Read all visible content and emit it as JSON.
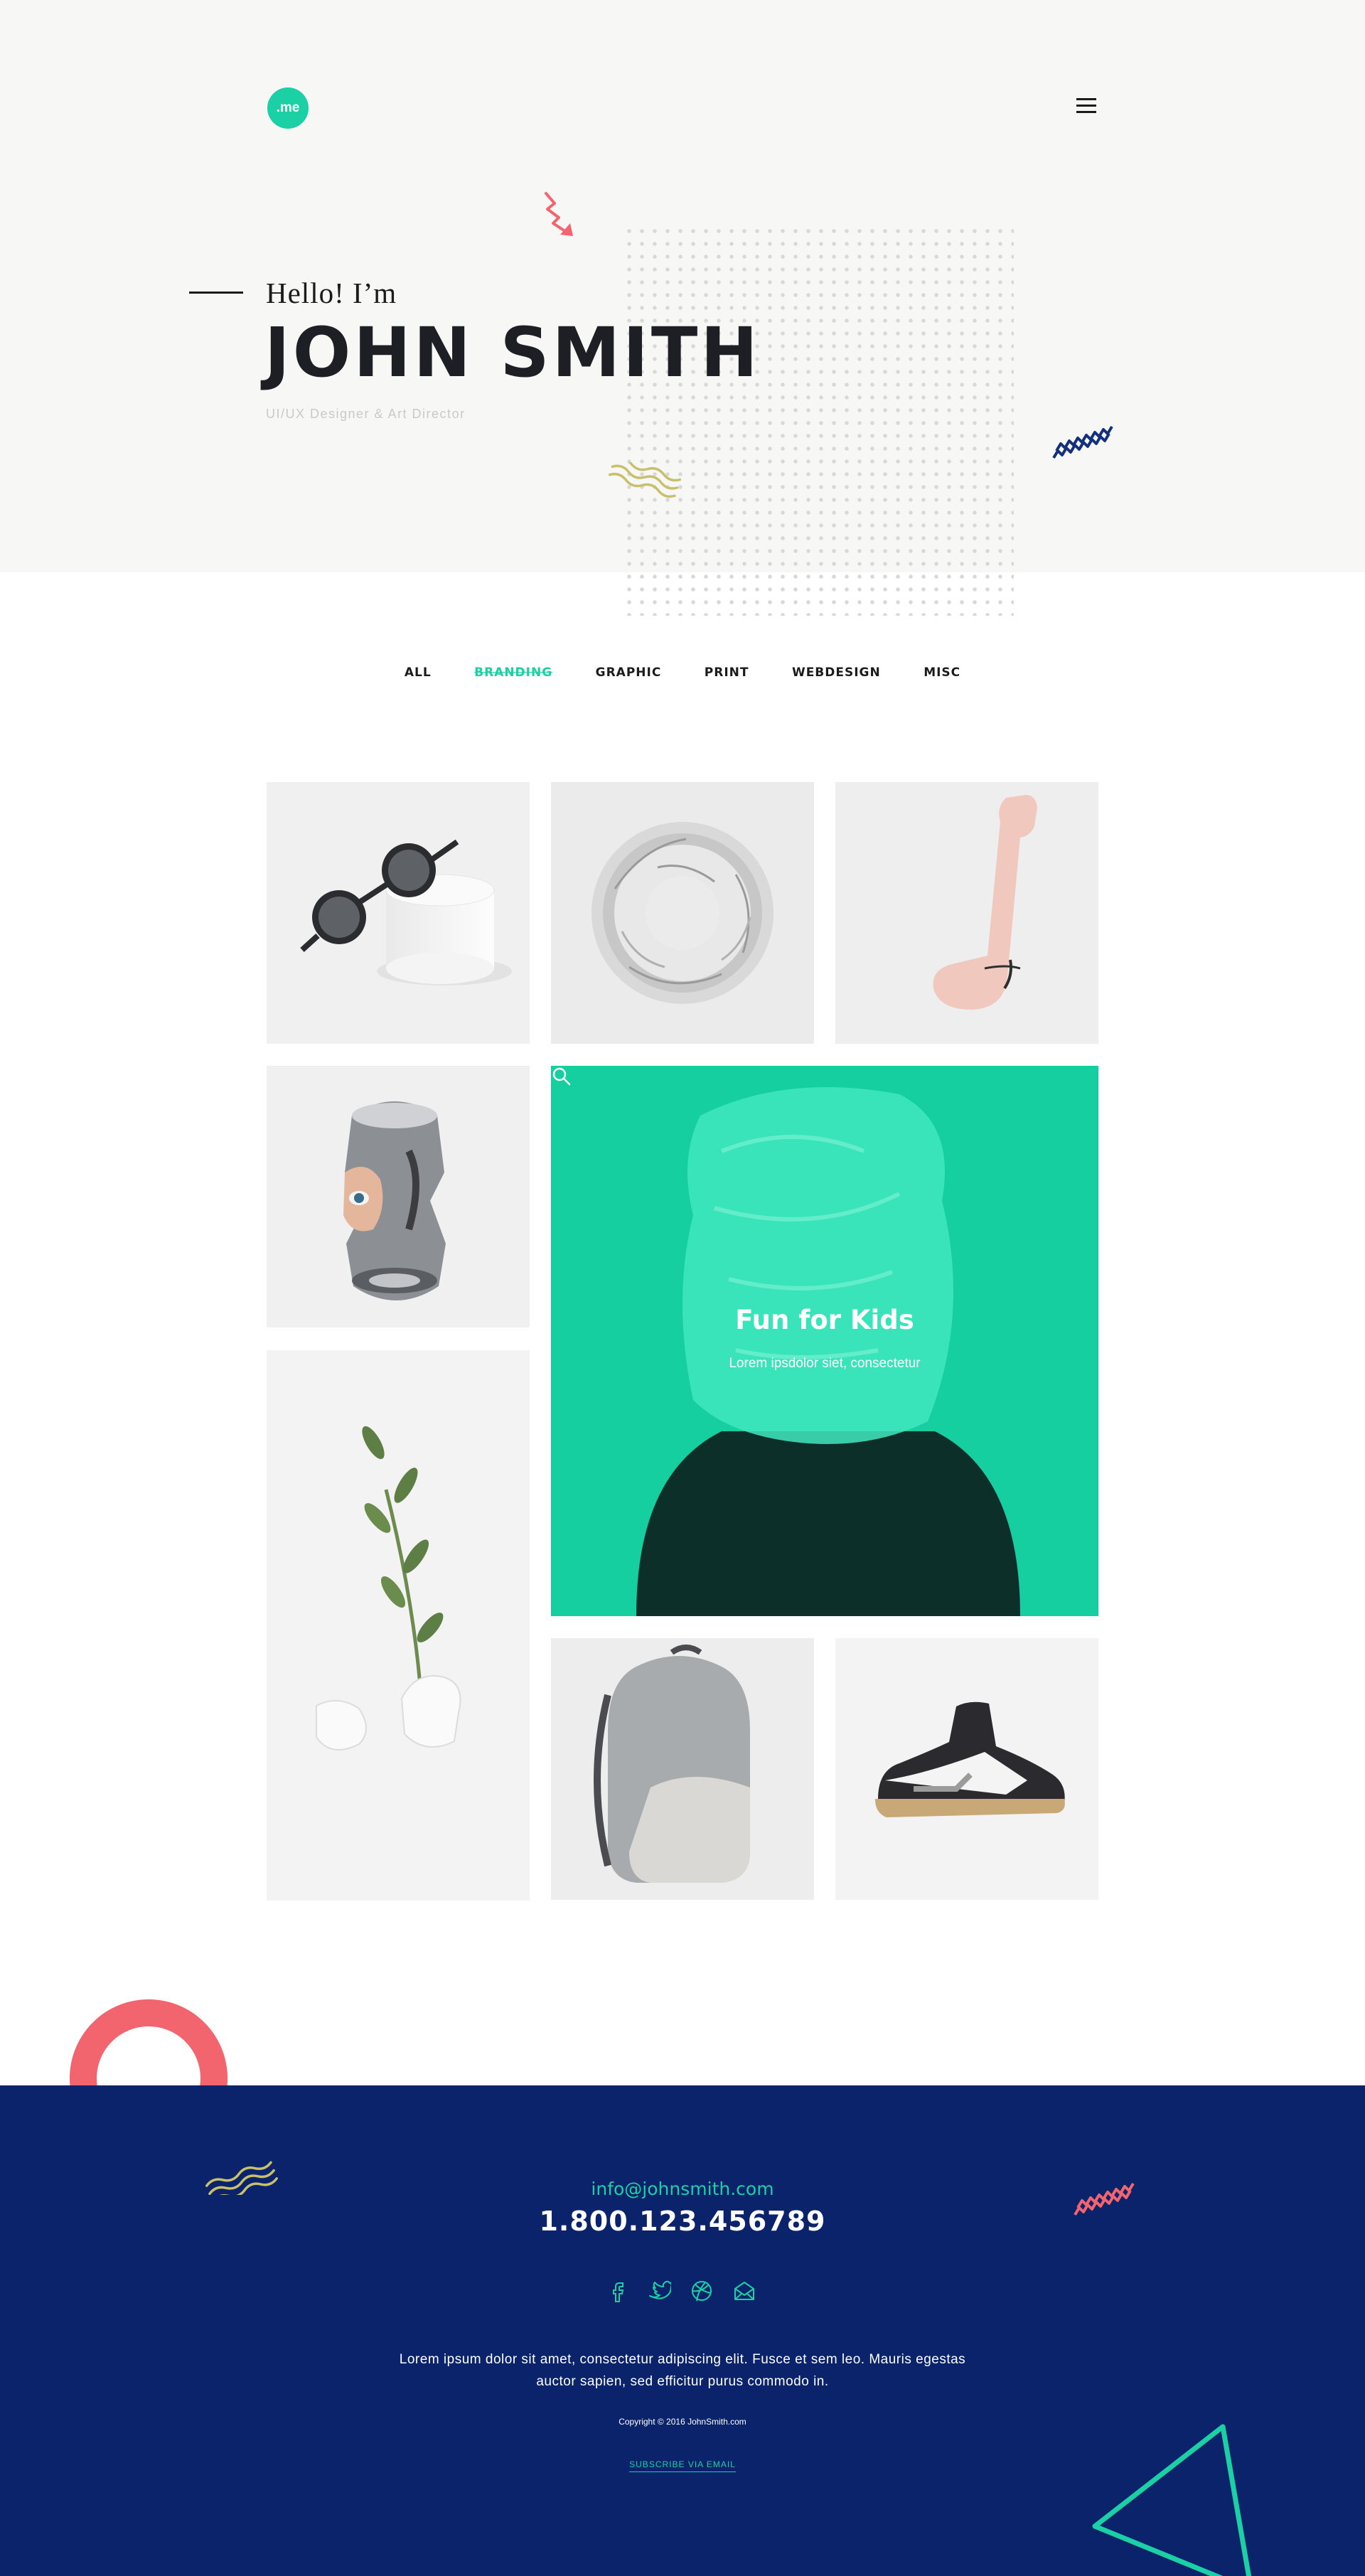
{
  "header": {
    "logo_text": ".me",
    "menu_icon": "hamburger-icon"
  },
  "hero": {
    "greeting": "Hello! I’m",
    "name": "JOHN SMITH",
    "role": "UI/UX Designer & Art Director"
  },
  "filters": [
    {
      "label": "ALL",
      "active": false
    },
    {
      "label": "BRANDING",
      "active": true
    },
    {
      "label": "GRAPHIC",
      "active": false
    },
    {
      "label": "PRINT",
      "active": false
    },
    {
      "label": "WEBDESIGN",
      "active": false
    },
    {
      "label": "MISC",
      "active": false
    }
  ],
  "featured": {
    "title": "Fun for Kids",
    "subtitle": "Lorem ipsdolor siet, consectetur",
    "icon": "search-icon"
  },
  "footer": {
    "email": "info@johnsmith.com",
    "phone": "1.800.123.456789",
    "socials": [
      "facebook-icon",
      "twitter-icon",
      "dribbble-icon",
      "email-icon"
    ],
    "text": "Lorem ipsum dolor sit amet, consectetur adipiscing elit. Fusce et sem leo. Mauris egestas auctor sapien, sed efficitur purus commodo in.",
    "copyright": "Copyright © 2016 JohnSmith.com",
    "subscribe": "SUBSCRIBE VIA EMAIL"
  },
  "colors": {
    "accent": "#1ad0a4",
    "footer_bg": "#0a236b",
    "coral": "#f2646e",
    "olive": "#c8c06a",
    "navy": "#13307a"
  }
}
